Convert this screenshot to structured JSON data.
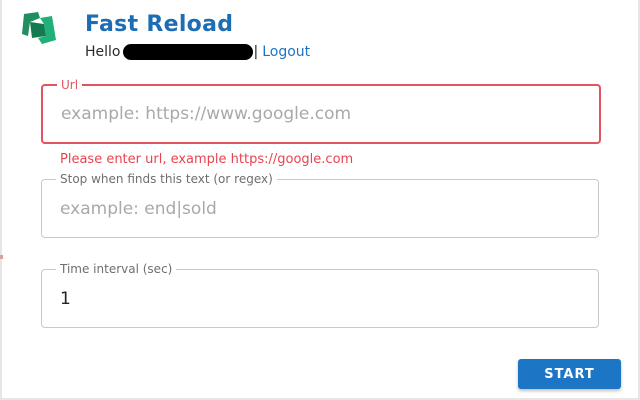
{
  "app": {
    "title": "Fast Reload",
    "brand_color": "#1d6db4",
    "logo_icon": "fast-reload-logo-icon"
  },
  "user": {
    "greeting": "Hello",
    "separator": "|",
    "logout_label": "Logout"
  },
  "url_field": {
    "label": "Url",
    "placeholder": "example: https://www.google.com",
    "value": "",
    "error_message": "Please enter url, example https://google.com",
    "error_color": "#e05561"
  },
  "stop_field": {
    "label": "Stop when finds this text (or regex)",
    "placeholder": "example: end|sold",
    "value": ""
  },
  "interval_field": {
    "label": "Time interval (sec)",
    "value": "1"
  },
  "actions": {
    "start_label": "START",
    "start_color": "#1d75c6"
  }
}
